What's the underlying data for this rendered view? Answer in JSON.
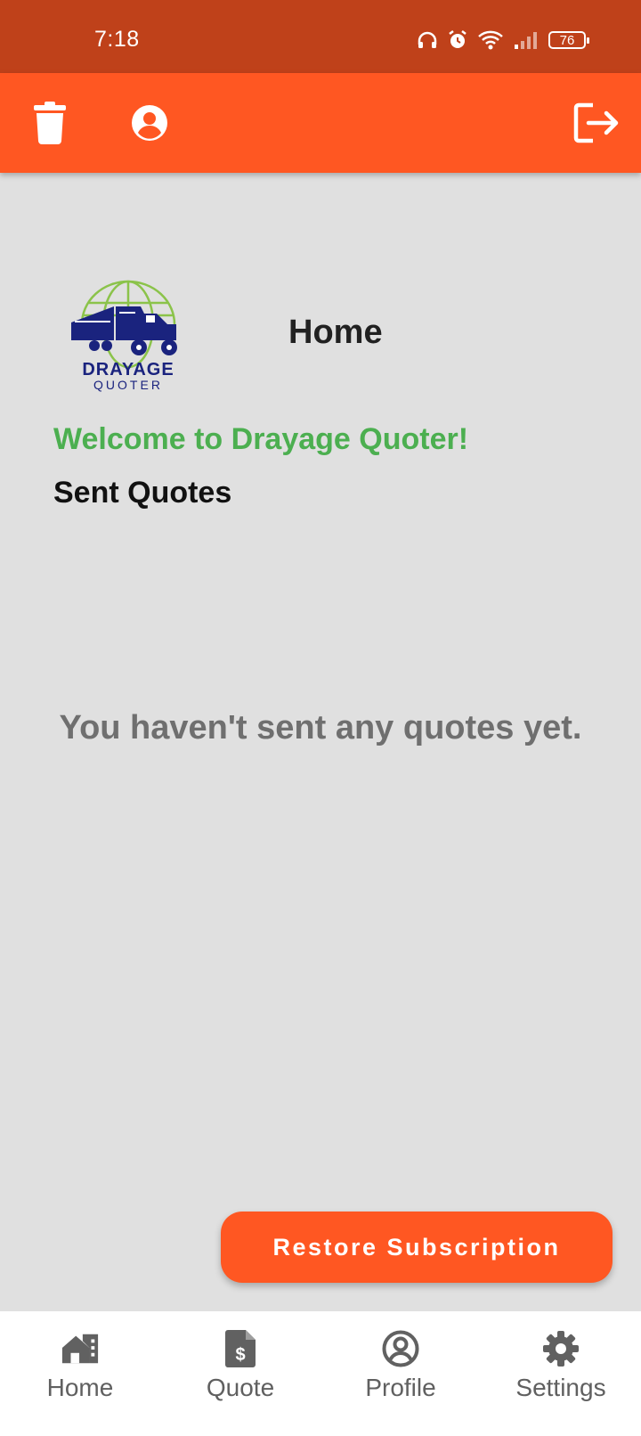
{
  "status_bar": {
    "time": "7:18",
    "battery": "76",
    "icons": [
      "headphones-icon",
      "alarm-icon",
      "wifi-icon",
      "signal-icon",
      "battery-icon"
    ]
  },
  "app_bar": {
    "color": "#ff5722",
    "icons": [
      "trash-icon",
      "account-circle-icon",
      "logout-icon"
    ]
  },
  "logo": {
    "line1": "DRAYAGE",
    "line2": "QUOTER"
  },
  "page": {
    "title": "Home",
    "welcome": "Welcome to Drayage Quoter!",
    "section_title": "Sent Quotes",
    "empty_message": "You haven't sent any quotes yet."
  },
  "restore_button": {
    "label": "Restore Subscription"
  },
  "bottom_nav": {
    "items": [
      {
        "label": "Home",
        "icon": "home-icon"
      },
      {
        "label": "Quote",
        "icon": "quote-document-icon"
      },
      {
        "label": "Profile",
        "icon": "profile-icon"
      },
      {
        "label": "Settings",
        "icon": "settings-gear-icon"
      }
    ]
  },
  "colors": {
    "status_bar": "#bf411a",
    "accent": "#ff5722",
    "welcome_green": "#4caf50",
    "background": "#e0e0e0"
  }
}
